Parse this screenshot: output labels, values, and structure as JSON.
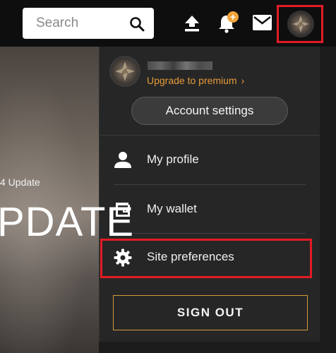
{
  "search": {
    "placeholder": "Search"
  },
  "notifications": {
    "badge": "+"
  },
  "hero": {
    "subtitle": "4 Update",
    "title": "PDATE"
  },
  "account": {
    "upgrade_label": "Upgrade to premium",
    "upgrade_chevron": "›",
    "settings_label": "Account settings"
  },
  "menu": {
    "items": [
      {
        "label": "My profile",
        "icon": "person-icon"
      },
      {
        "label": "My wallet",
        "icon": "wallet-icon"
      },
      {
        "label": "Site preferences",
        "icon": "gear-icon"
      }
    ]
  },
  "signout": {
    "label": "SIGN OUT"
  },
  "colors": {
    "accent": "#e69b3a",
    "highlight": "#e31b23",
    "topbar": "#0e0e0e",
    "dropdown": "#262626"
  }
}
